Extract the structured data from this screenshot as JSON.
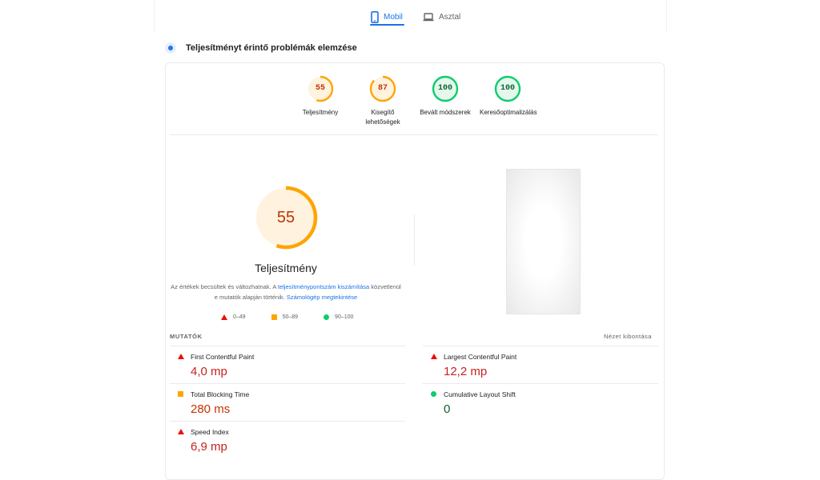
{
  "tabs": {
    "mobile": "Mobil",
    "desktop": "Asztal"
  },
  "section": {
    "title": "Teljesítményt érintő problémák elemzése"
  },
  "categories": [
    {
      "score": "55",
      "label": "Teljesítmény",
      "value": 55,
      "color": "#ffa400",
      "fill": "#fff3e0",
      "text_color": "#c33300"
    },
    {
      "score": "87",
      "label": "Kisegítő lehetőségek",
      "value": 87,
      "color": "#ffa400",
      "fill": "#fff3e0",
      "text_color": "#c33300"
    },
    {
      "score": "100",
      "label": "Bevált módszerek",
      "value": 100,
      "color": "#0cce6b",
      "fill": "#e6f7ee",
      "text_color": "#0d652d"
    },
    {
      "score": "100",
      "label": "Keresőoptimalizálás",
      "value": 100,
      "color": "#0cce6b",
      "fill": "#e6f7ee",
      "text_color": "#0d652d"
    }
  ],
  "main_gauge": {
    "score": "55",
    "value": 55,
    "label": "Teljesítmény",
    "color": "#ffa400",
    "fill": "#fff3e0"
  },
  "description": {
    "text1": "Az értékek becsültek és változhatnak. A ",
    "link1": "teljesítménypontszám kiszámítása",
    "text2": " közvetlenül e mutatók alapján történik. ",
    "link2": "Számológép megtekintése"
  },
  "legend": {
    "fail": "0–49",
    "average": "50–89",
    "pass": "90–100"
  },
  "metrics_section": {
    "label": "MUTATÓK",
    "expand": "Nézet kibontása"
  },
  "metrics": {
    "fcp": {
      "name": "First Contentful Paint",
      "value": "4,0 mp",
      "status": "fail"
    },
    "lcp": {
      "name": "Largest Contentful Paint",
      "value": "12,2 mp",
      "status": "fail"
    },
    "tbt": {
      "name": "Total Blocking Time",
      "value": "280 ms",
      "status": "average"
    },
    "cls": {
      "name": "Cumulative Layout Shift",
      "value": "0",
      "status": "pass"
    },
    "si": {
      "name": "Speed Index",
      "value": "6,9 mp",
      "status": "fail"
    }
  },
  "icons": {
    "mobile": "smartphone-icon",
    "desktop": "laptop-icon",
    "section": "lighthouse-icon",
    "fail": "red-triangle-icon",
    "average": "orange-square-icon",
    "pass": "green-circle-icon"
  },
  "colors": {
    "accent": "#1a73e8",
    "fail": "#eb0f00",
    "average": "#ffa400",
    "pass": "#0cce6b"
  }
}
